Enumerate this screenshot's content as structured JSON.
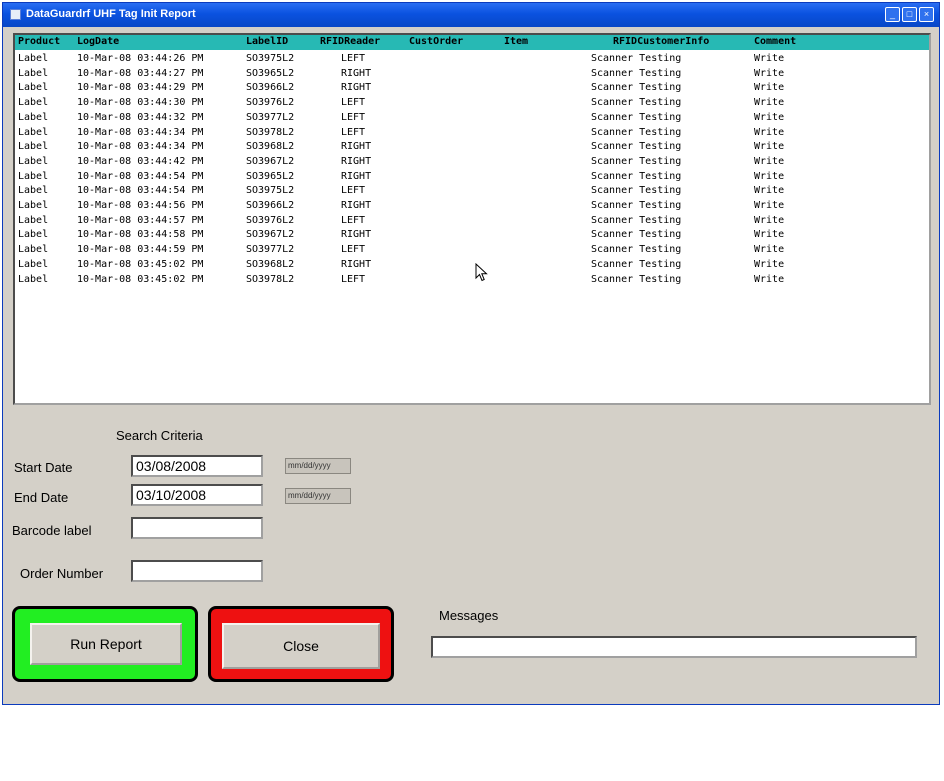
{
  "window": {
    "title": "DataGuardrf UHF Tag Init Report",
    "controls": [
      "_",
      "□",
      "×"
    ]
  },
  "grid": {
    "columns": [
      "Product",
      "LogDate",
      "LabelID",
      "RFIDReader",
      "CustOrder",
      "Item",
      "RFIDCustomerInfo",
      "Comment"
    ],
    "rows": [
      [
        "Label",
        "10-Mar-08 03:44:26 PM",
        "SO3975L2",
        "LEFT",
        "",
        "",
        "Scanner Testing",
        "Write"
      ],
      [
        "Label",
        "10-Mar-08 03:44:27 PM",
        "SO3965L2",
        "RIGHT",
        "",
        "",
        "Scanner Testing",
        "Write"
      ],
      [
        "Label",
        "10-Mar-08 03:44:29 PM",
        "SO3966L2",
        "RIGHT",
        "",
        "",
        "Scanner Testing",
        "Write"
      ],
      [
        "Label",
        "10-Mar-08 03:44:30 PM",
        "SO3976L2",
        "LEFT",
        "",
        "",
        "Scanner Testing",
        "Write"
      ],
      [
        "Label",
        "10-Mar-08 03:44:32 PM",
        "SO3977L2",
        "LEFT",
        "",
        "",
        "Scanner Testing",
        "Write"
      ],
      [
        "Label",
        "10-Mar-08 03:44:34 PM",
        "SO3978L2",
        "LEFT",
        "",
        "",
        "Scanner Testing",
        "Write"
      ],
      [
        "Label",
        "10-Mar-08 03:44:34 PM",
        "SO3968L2",
        "RIGHT",
        "",
        "",
        "Scanner Testing",
        "Write"
      ],
      [
        "Label",
        "10-Mar-08 03:44:42 PM",
        "SO3967L2",
        "RIGHT",
        "",
        "",
        "Scanner Testing",
        "Write"
      ],
      [
        "Label",
        "10-Mar-08 03:44:54 PM",
        "SO3965L2",
        "RIGHT",
        "",
        "",
        "Scanner Testing",
        "Write"
      ],
      [
        "Label",
        "10-Mar-08 03:44:54 PM",
        "SO3975L2",
        "LEFT",
        "",
        "",
        "Scanner Testing",
        "Write"
      ],
      [
        "Label",
        "10-Mar-08 03:44:56 PM",
        "SO3966L2",
        "RIGHT",
        "",
        "",
        "Scanner Testing",
        "Write"
      ],
      [
        "Label",
        "10-Mar-08 03:44:57 PM",
        "SO3976L2",
        "LEFT",
        "",
        "",
        "Scanner Testing",
        "Write"
      ],
      [
        "Label",
        "10-Mar-08 03:44:58 PM",
        "SO3967L2",
        "RIGHT",
        "",
        "",
        "Scanner Testing",
        "Write"
      ],
      [
        "Label",
        "10-Mar-08 03:44:59 PM",
        "SO3977L2",
        "LEFT",
        "",
        "",
        "Scanner Testing",
        "Write"
      ],
      [
        "Label",
        "10-Mar-08 03:45:02 PM",
        "SO3968L2",
        "RIGHT",
        "",
        "",
        "Scanner Testing",
        "Write"
      ],
      [
        "Label",
        "10-Mar-08 03:45:02 PM",
        "SO3978L2",
        "LEFT",
        "",
        "",
        "Scanner Testing",
        "Write"
      ]
    ]
  },
  "search": {
    "heading": "Search Criteria",
    "start_date_label": "Start Date",
    "start_date_value": "03/08/2008",
    "start_date_hint": "mm/dd/yyyy",
    "end_date_label": "End Date",
    "end_date_value": "03/10/2008",
    "end_date_hint": "mm/dd/yyyy",
    "barcode_label": "Barcode label",
    "barcode_value": "",
    "order_label": "Order Number",
    "order_value": ""
  },
  "buttons": {
    "run_report": "Run Report",
    "close": "Close",
    "run_frame_color": "#22ee22",
    "close_frame_color": "#ee1111"
  },
  "messages": {
    "label": "Messages",
    "value": ""
  },
  "icons": {
    "title": "app-icon",
    "cursor": "mouse-pointer-icon"
  }
}
